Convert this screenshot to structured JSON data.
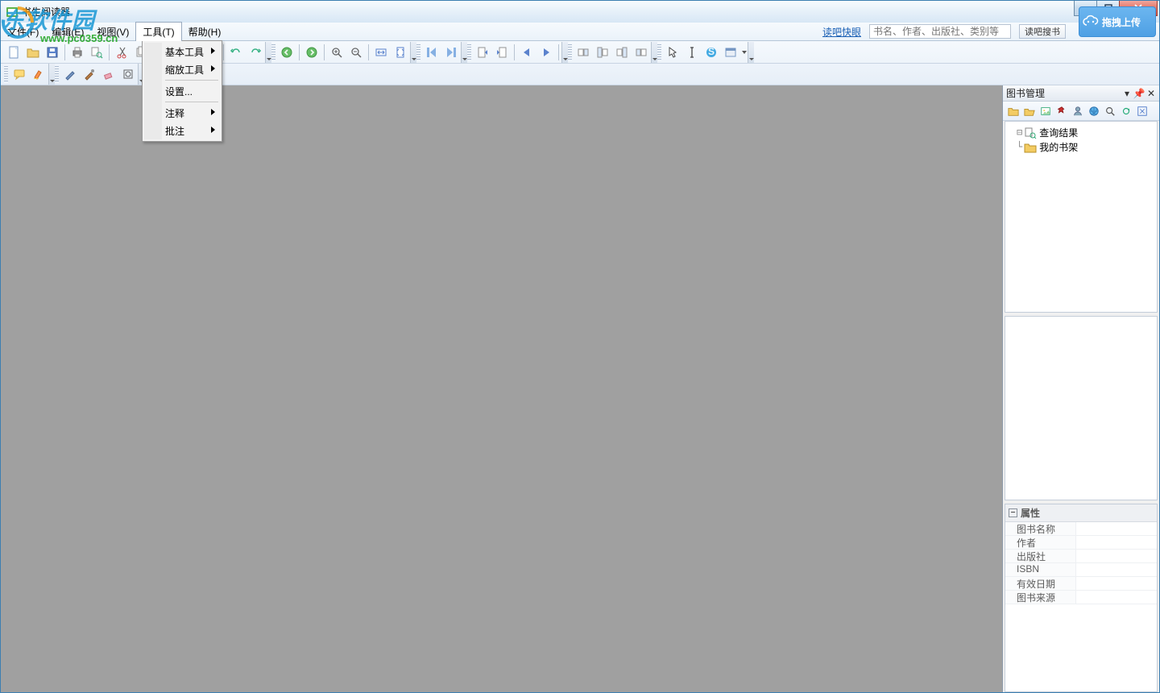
{
  "watermark": {
    "big": "东软件园",
    "small": "www.pc0359.cn"
  },
  "title": "书生阅读器",
  "menu": {
    "items": [
      "文件(F)",
      "编辑(E)",
      "视图(V)",
      "工具(T)",
      "帮助(H)"
    ],
    "open_index": 3,
    "dropdown": {
      "groups": [
        [
          {
            "label": "基本工具",
            "submenu": true
          },
          {
            "label": "缩放工具",
            "submenu": true
          }
        ],
        [
          {
            "label": "设置...",
            "submenu": false
          }
        ],
        [
          {
            "label": "注释",
            "submenu": true
          },
          {
            "label": "批注",
            "submenu": true
          }
        ]
      ]
    }
  },
  "header_right": {
    "link": "读吧快眼",
    "search_placeholder": "书名、作者、出版社、类别等",
    "search_button": "读吧搜书",
    "upload": "拖拽上传"
  },
  "toolbar_icons_row1": [
    "new",
    "open",
    "save",
    "sep",
    "print",
    "print-preview",
    "sep",
    "cut",
    "copy",
    "paste",
    "overflow",
    "grip",
    "hand",
    "select-text",
    "sep",
    "undo",
    "redo",
    "overflow",
    "grip",
    "nav-back",
    "sep",
    "nav-forward",
    "sep",
    "zoom-in",
    "zoom-out",
    "sep",
    "fit-width",
    "fit-page",
    "overflow",
    "grip",
    "first-page",
    "last-page",
    "overflow",
    "grip",
    "page-thumb-prev",
    "page-thumb-next",
    "sep",
    "play-left",
    "play-right",
    "sep",
    "overflow",
    "grip",
    "rotate-left",
    "rotate-ccw",
    "rotate-cw",
    "rotate-right",
    "overflow",
    "grip",
    "pointer",
    "text-cursor",
    "skype",
    "window",
    "drop",
    "overflow"
  ],
  "toolbar_icons_row2": [
    "grip",
    "comment",
    "highlight",
    "overflow",
    "grip",
    "pen",
    "brush",
    "eraser",
    "shape",
    "overflow"
  ],
  "rightpanel": {
    "title": "图书管理",
    "mini_icons": [
      "folder",
      "folder-open",
      "image",
      "pin",
      "user",
      "globe",
      "search",
      "refresh",
      "expand"
    ],
    "tree": [
      {
        "icon": "search-result",
        "label": "查询结果"
      },
      {
        "icon": "folder",
        "label": "我的书架"
      }
    ],
    "properties": {
      "header": "属性",
      "rows": [
        "图书名称",
        "作者",
        "出版社",
        "ISBN",
        "有效日期",
        "图书来源"
      ]
    }
  }
}
